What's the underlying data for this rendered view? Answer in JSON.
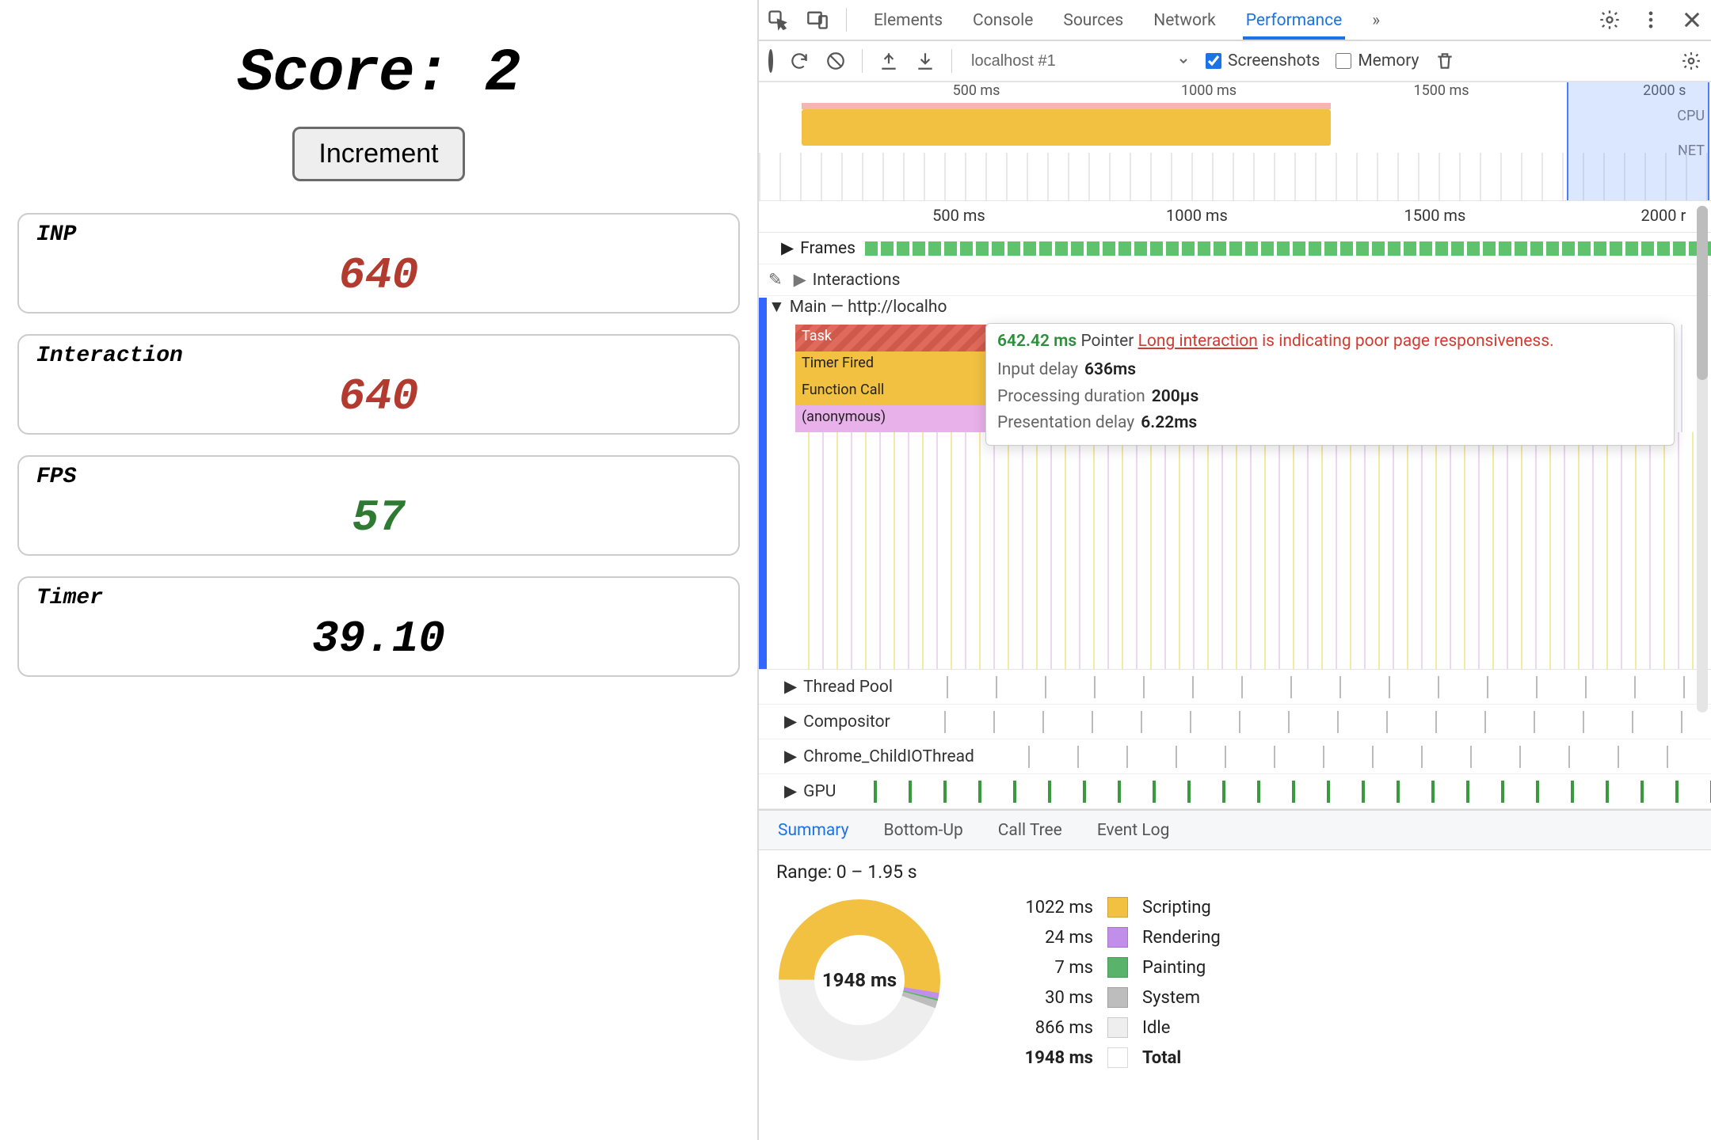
{
  "page": {
    "score_label": "Score:",
    "score_value": "2",
    "increment_label": "Increment",
    "cards": {
      "inp": {
        "label": "INP",
        "value": "640"
      },
      "interaction": {
        "label": "Interaction",
        "value": "640"
      },
      "fps": {
        "label": "FPS",
        "value": "57"
      },
      "timer": {
        "label": "Timer",
        "value": "39.10"
      }
    }
  },
  "devtools": {
    "tabs": [
      "Elements",
      "Console",
      "Sources",
      "Network",
      "Performance"
    ],
    "active_tab": "Performance",
    "more_glyph": "»",
    "perfbar": {
      "target": "localhost #1",
      "cb_screenshots": "Screenshots",
      "cb_memory": "Memory"
    },
    "overview": {
      "ticks": [
        "500 ms",
        "1000 ms",
        "1500 ms",
        "2000 s"
      ],
      "cpu_label": "CPU",
      "net_label": "NET"
    },
    "ruler2": [
      "500 ms",
      "1000 ms",
      "1500 ms",
      "2000 r"
    ],
    "tracks": {
      "frames": "Frames",
      "interactions": "Interactions",
      "main": "Main — http://localho",
      "task": "Task",
      "timer_fired": "Timer Fired",
      "function_call": "Function Call",
      "anonymous": "(anonymous)",
      "thread_pool": "Thread Pool",
      "compositor": "Compositor",
      "child_io": "Chrome_ChildIOThread",
      "gpu": "GPU"
    },
    "tooltip": {
      "ms": "642.42 ms",
      "pointer": "Pointer",
      "link": "Long interaction",
      "tail": "is indicating poor page responsiveness.",
      "rows": [
        {
          "k": "Input delay",
          "v": "636ms"
        },
        {
          "k": "Processing duration",
          "v": "200µs"
        },
        {
          "k": "Presentation delay",
          "v": "6.22ms"
        }
      ]
    },
    "bottom_tabs": [
      "Summary",
      "Bottom-Up",
      "Call Tree",
      "Event Log"
    ],
    "active_bottom_tab": "Summary",
    "summary": {
      "range": "Range: 0 – 1.95 s",
      "center": "1948 ms",
      "legend": [
        {
          "ms": "1022 ms",
          "color": "#f3c141",
          "name": "Scripting"
        },
        {
          "ms": "24 ms",
          "color": "#c18eea",
          "name": "Rendering"
        },
        {
          "ms": "7 ms",
          "color": "#59b36a",
          "name": "Painting"
        },
        {
          "ms": "30 ms",
          "color": "#bdbdbd",
          "name": "System"
        },
        {
          "ms": "866 ms",
          "color": "#eeeeee",
          "name": "Idle"
        },
        {
          "ms": "1948 ms",
          "color": "#ffffff",
          "name": "Total",
          "total": true
        }
      ]
    }
  },
  "chart_data": {
    "type": "pie",
    "title": "Performance summary",
    "unit": "ms",
    "total": 1948,
    "series": [
      {
        "name": "Scripting",
        "value": 1022,
        "color": "#f3c141"
      },
      {
        "name": "Rendering",
        "value": 24,
        "color": "#c18eea"
      },
      {
        "name": "Painting",
        "value": 7,
        "color": "#59b36a"
      },
      {
        "name": "System",
        "value": 30,
        "color": "#bdbdbd"
      },
      {
        "name": "Idle",
        "value": 866,
        "color": "#eeeeee"
      }
    ]
  }
}
